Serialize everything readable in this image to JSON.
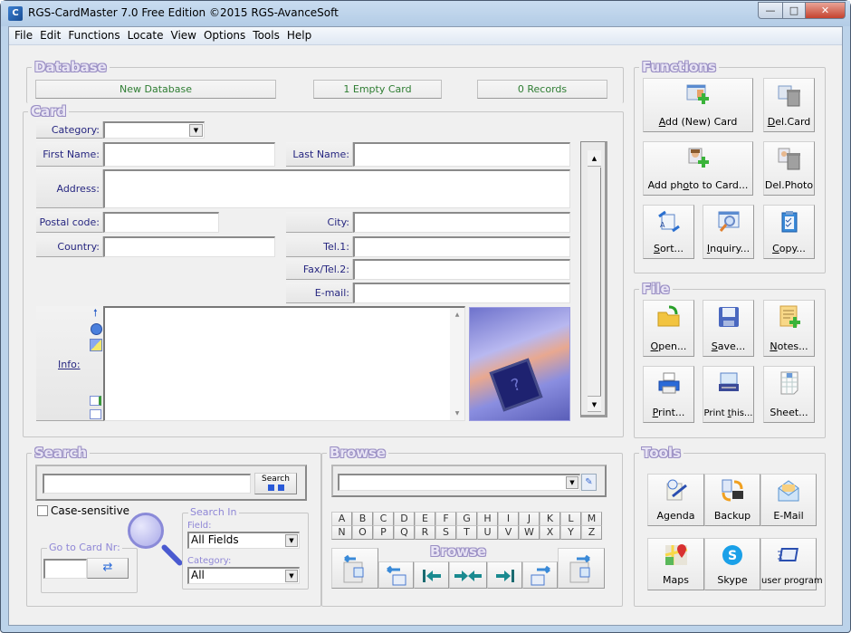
{
  "window": {
    "title": "RGS-CardMaster 7.0 Free Edition ©2015 RGS-AvanceSoft",
    "app_icon": "rgs-cardmaster-icon",
    "controls": {
      "minimize": "—",
      "maximize": "□",
      "close": "✕"
    }
  },
  "menu": [
    "File",
    "Edit",
    "Functions",
    "Locate",
    "View",
    "Options",
    "Tools",
    "Help"
  ],
  "database": {
    "legend": "Database",
    "name": "New Database",
    "empty_cards": "1 Empty Card",
    "records": "0 Records",
    "status_color": "#2e7d32"
  },
  "card": {
    "legend": "Card",
    "fields": {
      "category": {
        "label": "Category:",
        "value": ""
      },
      "first_name": {
        "label": "First Name:",
        "value": ""
      },
      "last_name": {
        "label": "Last Name:",
        "value": ""
      },
      "address": {
        "label": "Address:",
        "value": ""
      },
      "postal_code": {
        "label": "Postal code:",
        "value": ""
      },
      "city": {
        "label": "City:",
        "value": ""
      },
      "country": {
        "label": "Country:",
        "value": ""
      },
      "tel1": {
        "label": "Tel.1:",
        "value": ""
      },
      "fax_tel2": {
        "label": "Fax/Tel.2:",
        "value": ""
      },
      "email": {
        "label": "E-mail:",
        "value": ""
      },
      "info": {
        "label": "Info:",
        "value": ""
      }
    },
    "info_icons": [
      "upload-arrow-icon",
      "clock-icon",
      "search-person-icon",
      "add-image-icon",
      "folder-icon"
    ],
    "photo": "placeholder-photo"
  },
  "functions": {
    "legend": "Functions",
    "buttons": [
      {
        "id": "add-card",
        "label": "Add (New) Card",
        "icon": "add-card-icon"
      },
      {
        "id": "del-card",
        "label": "Del.Card",
        "icon": "delete-card-icon"
      },
      {
        "id": "add-photo",
        "label": "Add photo to Card...",
        "icon": "add-photo-icon"
      },
      {
        "id": "del-photo",
        "label": "Del.Photo",
        "icon": "delete-photo-icon"
      },
      {
        "id": "sort",
        "label": "Sort...",
        "icon": "sort-icon"
      },
      {
        "id": "inquiry",
        "label": "Inquiry...",
        "icon": "inquiry-icon"
      },
      {
        "id": "copy",
        "label": "Copy...",
        "icon": "clipboard-icon"
      }
    ]
  },
  "file": {
    "legend": "File",
    "buttons": [
      {
        "id": "open",
        "label": "Open...",
        "icon": "folder-open-icon"
      },
      {
        "id": "save",
        "label": "Save...",
        "icon": "floppy-disk-icon"
      },
      {
        "id": "notes",
        "label": "Notes...",
        "icon": "notes-icon"
      },
      {
        "id": "print",
        "label": "Print...",
        "icon": "printer-icon"
      },
      {
        "id": "print-this",
        "label": "Print this...",
        "icon": "print-card-icon"
      },
      {
        "id": "sheet",
        "label": "Sheet...",
        "icon": "spreadsheet-icon"
      }
    ]
  },
  "tools": {
    "legend": "Tools",
    "buttons": [
      {
        "id": "agenda",
        "label": "Agenda",
        "icon": "agenda-icon"
      },
      {
        "id": "backup",
        "label": "Backup",
        "icon": "backup-icon"
      },
      {
        "id": "email",
        "label": "E-Mail",
        "icon": "envelope-icon"
      },
      {
        "id": "maps",
        "label": "Maps",
        "icon": "map-pin-icon"
      },
      {
        "id": "skype",
        "label": "Skype",
        "icon": "skype-icon"
      },
      {
        "id": "user-program",
        "label": "user program",
        "icon": "program-window-icon"
      }
    ]
  },
  "search": {
    "legend": "Search",
    "query": "",
    "search_button": "Search",
    "case_sensitive": {
      "label": "Case-sensitive",
      "checked": false
    },
    "go_to_card": {
      "legend": "Go to Card Nr:",
      "value": ""
    },
    "search_in": {
      "legend": "Search In",
      "field_label": "Field:",
      "field_value": "All Fields",
      "category_label": "Category:",
      "category_value": "All"
    }
  },
  "browse": {
    "legend": "Browse",
    "combo_value": "",
    "letters_row1": [
      "A",
      "B",
      "C",
      "D",
      "E",
      "F",
      "G",
      "H",
      "I",
      "J",
      "K",
      "L",
      "M"
    ],
    "letters_row2": [
      "N",
      "O",
      "P",
      "Q",
      "R",
      "S",
      "T",
      "U",
      "V",
      "W",
      "X",
      "Y",
      "Z"
    ],
    "nav_label": "Browse",
    "nav_buttons": [
      "first-card-icon",
      "previous-card-icon",
      "go-first-icon",
      "go-middle-icon",
      "go-last-icon",
      "next-card-icon",
      "last-card-icon"
    ]
  }
}
